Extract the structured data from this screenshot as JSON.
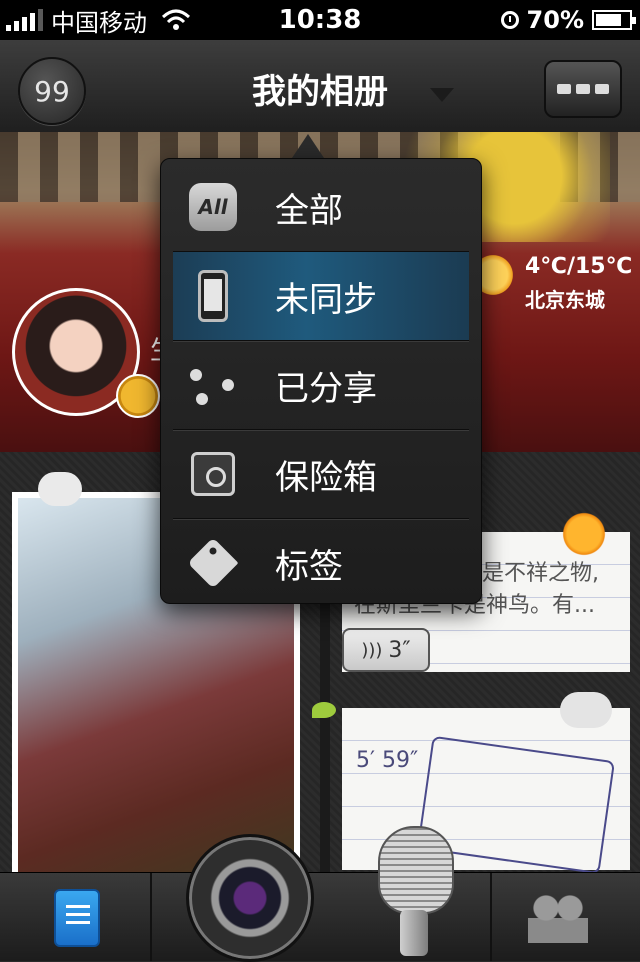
{
  "status_bar": {
    "carrier": "中国移动",
    "time": "10:38",
    "battery": "70%"
  },
  "nav": {
    "count": "99",
    "title": "我的相册"
  },
  "banner": {
    "temperature": "4℃/15℃",
    "city": "北京东城",
    "partial_label": "生"
  },
  "dropdown": {
    "items": [
      {
        "label": "全部",
        "icon": "all-icon",
        "selected": false,
        "icon_text": "All"
      },
      {
        "label": "未同步",
        "icon": "phone-icon",
        "selected": true
      },
      {
        "label": "已分享",
        "icon": "share-icon",
        "selected": false
      },
      {
        "label": "保险箱",
        "icon": "safe-icon",
        "selected": false
      },
      {
        "label": "标签",
        "icon": "tag-icon",
        "selected": false
      }
    ]
  },
  "timeline": {
    "note1_text_line1": "是不祥之物,",
    "note1_text_line2": "在斯里兰卡是神鸟。有...",
    "note1_duration": "3″",
    "note2_duration": "5′ 59″"
  },
  "bottom_bar": {
    "tabs": [
      "notebook-icon",
      "camera-icon",
      "microphone-icon",
      "people-icon"
    ]
  }
}
